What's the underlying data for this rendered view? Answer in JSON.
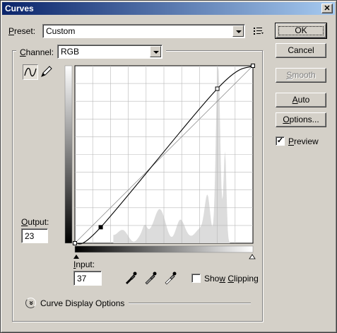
{
  "window": {
    "title": "Curves",
    "close_glyph": "✕"
  },
  "preset": {
    "label_prefix": "P",
    "label_rest": "reset:",
    "value": "Custom",
    "menu_icon": "list-menu-icon"
  },
  "channel": {
    "label_prefix": "C",
    "label_rest": "hannel:",
    "value": "RGB"
  },
  "buttons": {
    "ok": "OK",
    "cancel": "Cancel",
    "smooth_prefix": "S",
    "smooth_rest": "mooth",
    "auto_prefix": "A",
    "auto_rest": "uto",
    "options_prefix": "O",
    "options_rest": "ptions..."
  },
  "preview": {
    "label_prefix": "P",
    "label_rest": "review",
    "checked": true,
    "check_glyph": "✓"
  },
  "output": {
    "label_prefix": "O",
    "label_rest": "utput:",
    "value": "23"
  },
  "input": {
    "label_prefix": "I",
    "label_rest": "nput:",
    "value": "37"
  },
  "show_clipping": {
    "label_a": "Sho",
    "label_u": "w",
    "label_b": " ",
    "label_c": "C",
    "label_d": "lipping",
    "checked": false
  },
  "curve_display": {
    "label": "Curve Display Options",
    "toggle_glyph": "»"
  },
  "tools": {
    "curve_tool": "curve-point-tool-icon",
    "pencil_tool": "pencil-tool-icon"
  },
  "eyedroppers": [
    "black-point-eyedropper-icon",
    "gray-point-eyedropper-icon",
    "white-point-eyedropper-icon"
  ],
  "chart_data": {
    "type": "line",
    "title": "",
    "xlabel": "Input",
    "ylabel": "Output",
    "xlim": [
      0,
      255
    ],
    "ylim": [
      0,
      255
    ],
    "grid": true,
    "curve_points": [
      [
        0,
        0
      ],
      [
        37,
        23
      ],
      [
        204,
        222
      ],
      [
        255,
        255
      ]
    ],
    "diagonal_baseline": [
      [
        0,
        0
      ],
      [
        255,
        255
      ]
    ],
    "selected_point": [
      37,
      23
    ],
    "histogram_color": "#dcdcdc"
  }
}
